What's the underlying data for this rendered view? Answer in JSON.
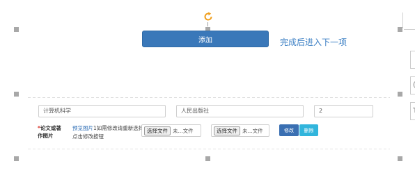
{
  "top_section": {
    "add_button_label": "添加",
    "next_step_link": "完成后进入下一项"
  },
  "book_row": {
    "subject_value": "计算机科学",
    "publisher_value": "人民出版社",
    "count_value": "2"
  },
  "image_row": {
    "required_mark": "*",
    "label_line1": "论文或著",
    "label_line2": "作图片",
    "preview_link": "预览图片",
    "preview_hint": "1如需修改请重新选择并点击修改按钮",
    "file_picker_1": {
      "button_label": "选择文件",
      "status": "未...文件"
    },
    "file_picker_2": {
      "button_label": "选择文件",
      "status": "未...文件"
    },
    "modify_button_label": "修改",
    "delete_button_label": "删除"
  },
  "right_edge_fragments": {
    "box_2": "(",
    "box_3": "T"
  },
  "colors": {
    "primary": "#3a78b9",
    "link": "#3b7fc4",
    "delete": "#31b5dc",
    "required": "#d9342b",
    "rotate_handle": "#f0a020"
  }
}
